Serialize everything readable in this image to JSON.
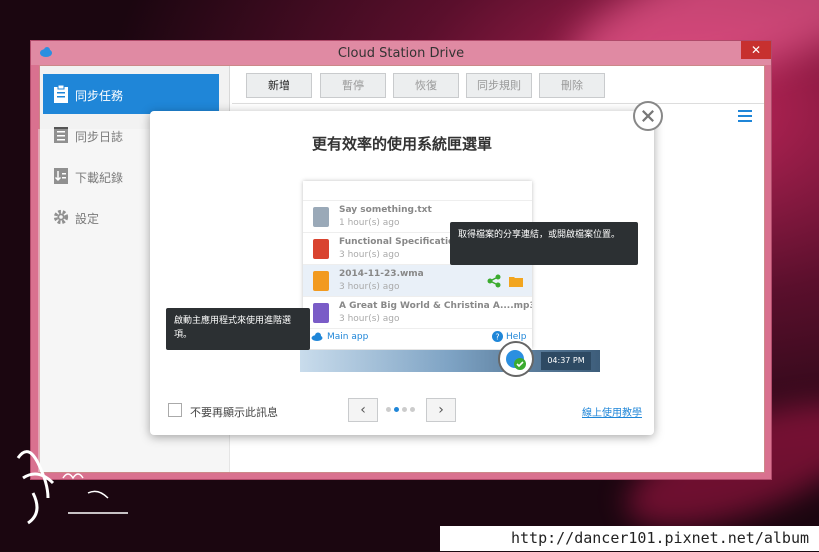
{
  "window": {
    "title": "Cloud Station Drive",
    "close_label": "✕"
  },
  "sidebar": {
    "items": [
      {
        "label": "同步任務",
        "icon": "clipboard-icon",
        "active": true
      },
      {
        "label": "同步日誌",
        "icon": "list-icon",
        "active": false
      },
      {
        "label": "下載紀錄",
        "icon": "download-list-icon",
        "active": false
      },
      {
        "label": "設定",
        "icon": "gear-icon",
        "active": false
      }
    ]
  },
  "toolbar": {
    "buttons": [
      "新增",
      "暫停",
      "恢復",
      "同步規則",
      "刪除"
    ]
  },
  "dialog": {
    "title": "更有效率的使用系統匣選單",
    "files": [
      {
        "name": "Say something.txt",
        "time": "1 hour(s) ago",
        "color": "#9aa9b8"
      },
      {
        "name": "Functional Specification...",
        "time": "3 hour(s) ago",
        "color": "#d9432f"
      },
      {
        "name": "2014-11-23.wma",
        "time": "3 hour(s) ago",
        "color": "#f29a1f"
      },
      {
        "name": "A Great Big World & Christina A....mp3",
        "time": "3 hour(s) ago",
        "color": "#7a5cc7"
      }
    ],
    "footer_main": "Main app",
    "footer_help": "Help",
    "clock": "04:37 PM",
    "tip_right": "取得檔案的分享連結，或開啟檔案位置。",
    "tip_left": "啟動主應用程式來使用進階選項。",
    "checkbox_label": "不要再顯示此訊息",
    "prev": "‹",
    "next": "›",
    "link": "線上使用教學"
  },
  "watermark": {
    "url": "http://dancer101.pixnet.net/album"
  },
  "colors": {
    "accent": "#1f86d8",
    "titlebar": "#e08aa3",
    "close": "#c7302f"
  }
}
